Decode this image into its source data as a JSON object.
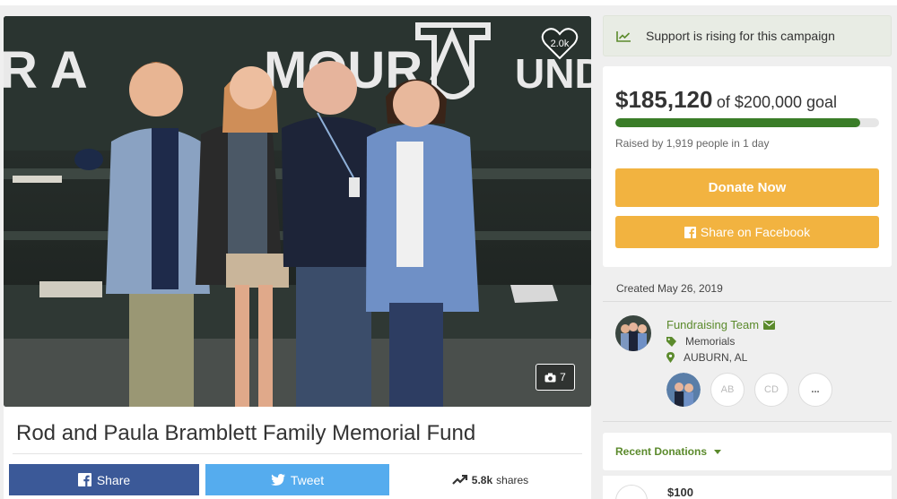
{
  "campaign": {
    "title": "Rod and Paula Bramblett Family Memorial Fund",
    "hearts": "2.0k",
    "photo_count": "7",
    "photo_sign": {
      "left": "R A",
      "mid": "MOUR",
      "right": "UND"
    }
  },
  "share_bar": {
    "facebook_label": "Share",
    "tweet_label": "Tweet",
    "shares_count": "5.8k",
    "shares_word": "shares"
  },
  "support_banner": {
    "text": "Support is rising for this campaign"
  },
  "progress": {
    "raised": "$185,120",
    "goal_text": "of $200,000 goal",
    "fraction": 0.93,
    "raised_by": "Raised by 1,919 people in 1 day",
    "color": "#3a7d28"
  },
  "actions": {
    "donate_label": "Donate Now",
    "share_facebook_label": "Share on Facebook",
    "button_color": "#f2b340"
  },
  "meta": {
    "created": "Created May 26, 2019"
  },
  "team": {
    "name": "Fundraising Team",
    "category": "Memorials",
    "location": "AUBURN, AL",
    "members": [
      "AB",
      "CD",
      "..."
    ]
  },
  "donations": {
    "header": "Recent Donations",
    "first_amount": "$100"
  },
  "icons": {
    "heart": "heart-icon",
    "camera": "camera-icon",
    "trend": "trending-up-icon",
    "facebook": "facebook-icon",
    "twitter": "twitter-icon",
    "mail": "envelope-icon",
    "tag": "tag-icon",
    "pin": "map-pin-icon",
    "caret": "caret-down-icon"
  }
}
